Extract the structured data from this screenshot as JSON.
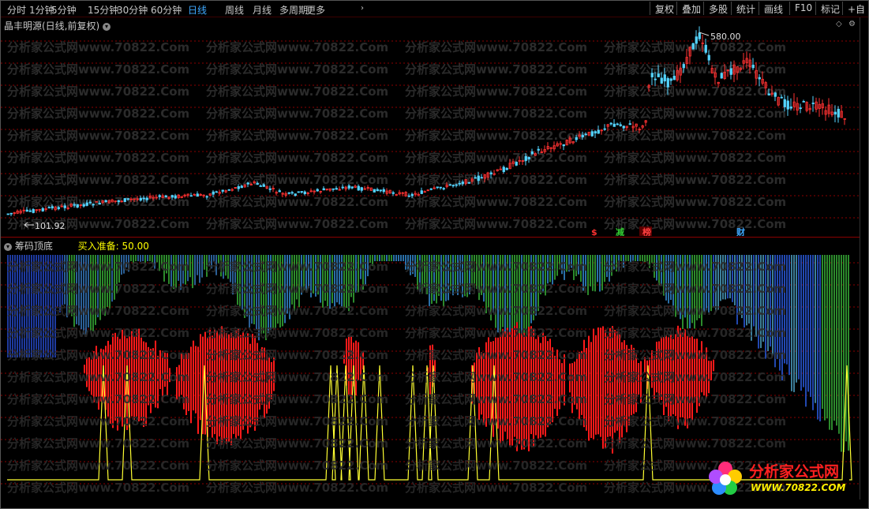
{
  "toolbar": {
    "periods": [
      "分时",
      "1分钟",
      "5分钟",
      "15分钟",
      "30分钟",
      "60分钟",
      "日线",
      "周线",
      "月线",
      "多周期",
      "更多"
    ],
    "active_period": "日线",
    "right_buttons": [
      "复权",
      "叠加",
      "多股",
      "统计",
      "画线",
      "F10",
      "标记",
      "+自"
    ]
  },
  "main_chart": {
    "title": "晶丰明源(日线,前复权)",
    "high_label": "580.00",
    "low_label": "101.92",
    "event_tags": [
      {
        "text": "$",
        "color": "#ff3030"
      },
      {
        "text": "减",
        "color": "#33cc33"
      },
      {
        "text": "榜",
        "color": "#ff4040"
      },
      {
        "text": "财",
        "color": "#3fa9ff"
      }
    ],
    "colors": {
      "up": "#ff3232",
      "down": "#54d4ff",
      "grid": "#8b0000"
    }
  },
  "indicator": {
    "title": "筹码顶底",
    "param_label": "买入准备:",
    "param_value": "50.00",
    "colors": {
      "buy_bar": "#ff1a1a",
      "signal_line": "#ffff33",
      "chip_blue": "#1e3a9e",
      "chip_green": "#2c8a2c"
    }
  },
  "watermark": {
    "text": "分析家公式网www.70822.Com",
    "logo_title": "分析家公式网",
    "logo_url": "WWW.70822.COM"
  }
}
